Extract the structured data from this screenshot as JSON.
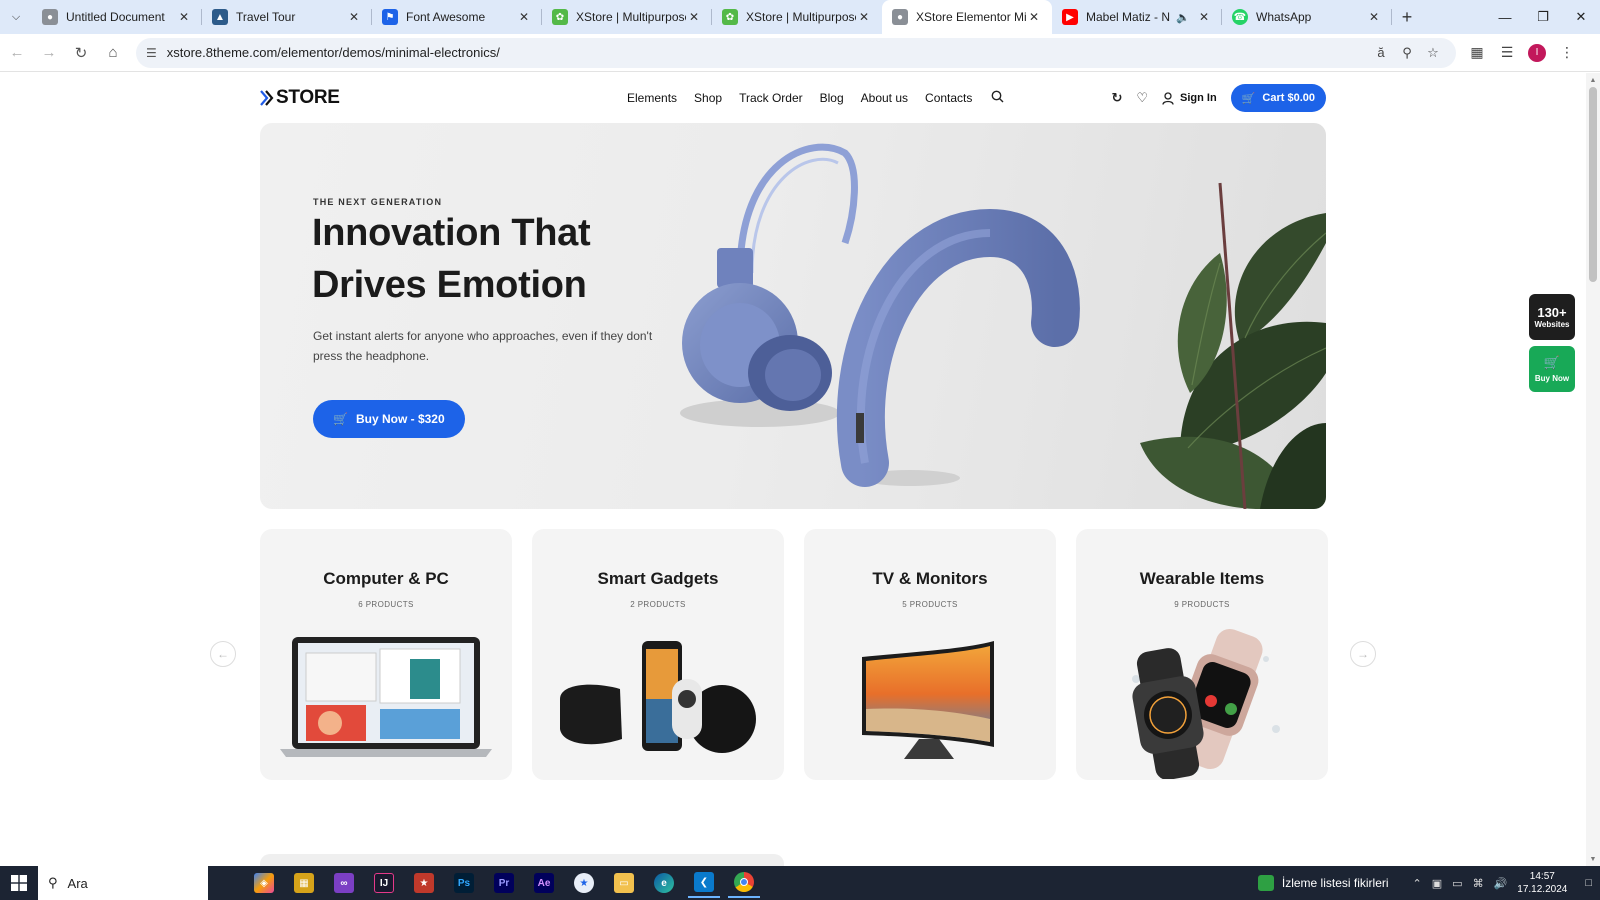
{
  "browser": {
    "tabs": [
      {
        "title": "Untitled Document",
        "favicon": "globe-icon",
        "color": "#5f6368",
        "active": false
      },
      {
        "title": "Travel Tour",
        "favicon": "image-icon",
        "color": "#2d5b8a",
        "active": false
      },
      {
        "title": "Font Awesome",
        "favicon": "flag-icon",
        "color": "#1d63e8",
        "active": false
      },
      {
        "title": "XStore | Multipurpose Wo",
        "favicon": "xstore-leaf-icon",
        "color": "#54b948",
        "active": false
      },
      {
        "title": "XStore | Multipurpose Wo",
        "favicon": "xstore-leaf-icon",
        "color": "#54b948",
        "active": false
      },
      {
        "title": "XStore Elementor Minima",
        "favicon": "globe-icon",
        "color": "#5f6368",
        "active": true
      },
      {
        "title": "Mabel Matiz - Numar",
        "favicon": "youtube-icon",
        "color": "#ff0000",
        "active": false,
        "audio": true
      },
      {
        "title": "WhatsApp",
        "favicon": "whatsapp-icon",
        "color": "#25d366",
        "active": false
      }
    ],
    "url": "xstore.8theme.com/elementor/demos/minimal-electronics/",
    "profile_initial": "I"
  },
  "site": {
    "logo": "STORE",
    "nav": [
      "Elements",
      "Shop",
      "Track Order",
      "Blog",
      "About us",
      "Contacts"
    ],
    "sign_in": "Sign In",
    "cart": "Cart $0.00",
    "accent_color": "#1d63e8"
  },
  "hero": {
    "tag": "THE NEXT GENERATION",
    "title_line1": "Innovation That",
    "title_line2": "Drives Emotion",
    "description": "Get instant alerts for anyone who approaches, even if they don't press the headphone.",
    "button": "Buy Now - $320"
  },
  "floating": {
    "websites_count": "130+",
    "websites_label": "Websites",
    "buy_label": "Buy Now"
  },
  "categories": [
    {
      "title": "Computer & PC",
      "count": "6 PRODUCTS",
      "image": "laptop"
    },
    {
      "title": "Smart Gadgets",
      "count": "2 PRODUCTS",
      "image": "gadgets"
    },
    {
      "title": "TV & Monitors",
      "count": "5 PRODUCTS",
      "image": "tv"
    },
    {
      "title": "Wearable Items",
      "count": "9 PRODUCTS",
      "image": "smartwatch"
    }
  ],
  "taskbar": {
    "search_placeholder": "Ara",
    "apps": [
      "copilot-icon",
      "file-manager-icon",
      "visual-studio-icon",
      "intellij-icon",
      "app-icon",
      "photoshop-icon",
      "premiere-icon",
      "after-effects-icon",
      "vpn-icon",
      "folder-icon",
      "edge-icon",
      "vscode-icon",
      "chrome-icon"
    ],
    "notification_app": "İzleme listesi fikirleri",
    "time": "14:57",
    "date": "17.12.2024"
  }
}
